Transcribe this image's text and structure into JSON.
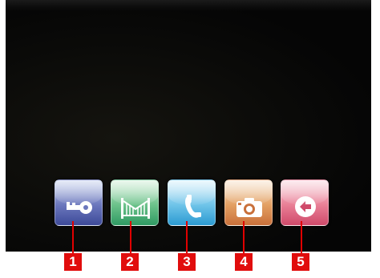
{
  "buttons": [
    {
      "id": "1",
      "icon": "key-icon",
      "label": "1"
    },
    {
      "id": "2",
      "icon": "gate-icon",
      "label": "2"
    },
    {
      "id": "3",
      "icon": "phone-icon",
      "label": "3"
    },
    {
      "id": "4",
      "icon": "camera-icon",
      "label": "4"
    },
    {
      "id": "5",
      "icon": "back-arrow-icon",
      "label": "5"
    }
  ],
  "colors": {
    "callout": "#e10d0d",
    "button_1": "#6b77bd",
    "button_2": "#6cc28a",
    "button_3": "#6fc4e9",
    "button_4": "#e3a063",
    "button_5": "#e97f96"
  }
}
